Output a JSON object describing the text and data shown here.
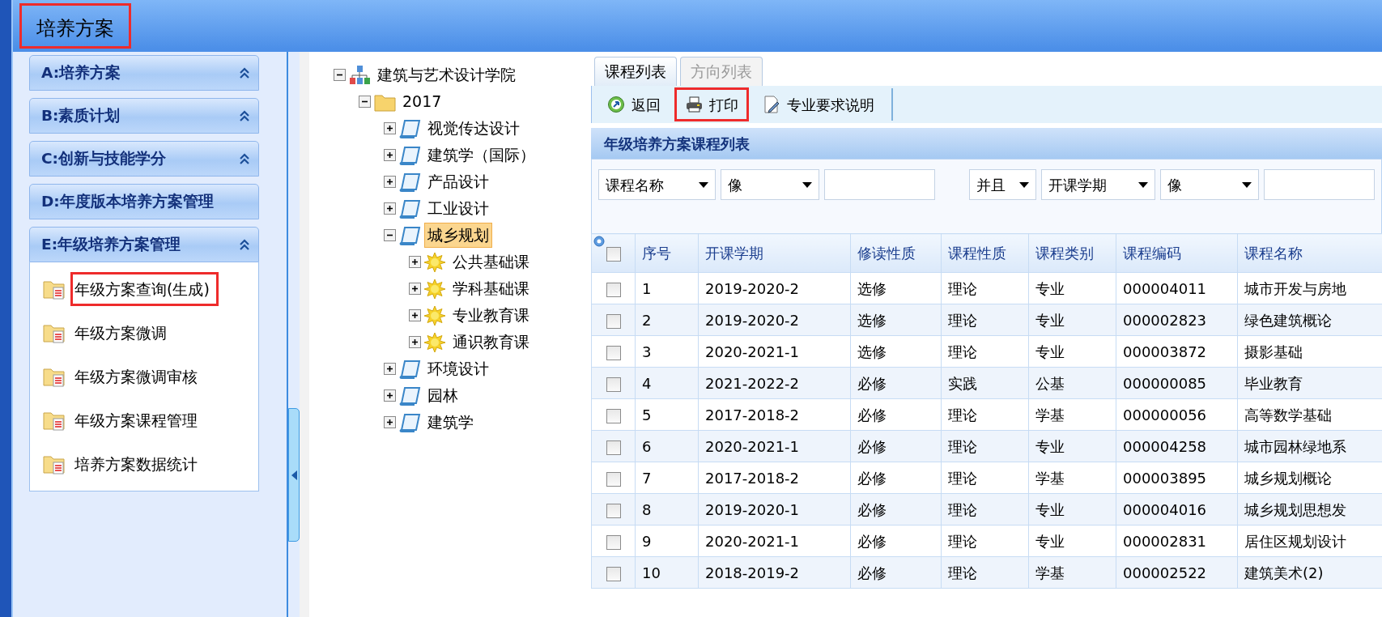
{
  "window": {
    "title": "培养方案",
    "highlighted": true
  },
  "sidebar": {
    "sections": [
      {
        "label": "A:培养方案",
        "toggle": true
      },
      {
        "label": "B:素质计划",
        "toggle": true
      },
      {
        "label": "C:创新与技能学分",
        "toggle": true
      },
      {
        "label": "D:年度版本培养方案管理",
        "toggle": false
      },
      {
        "label": "E:年级培养方案管理",
        "toggle": true,
        "expanded": true,
        "items": [
          {
            "label": "年级方案查询(生成)",
            "highlighted": true
          },
          {
            "label": "年级方案微调",
            "highlighted": false
          },
          {
            "label": "年级方案微调审核",
            "highlighted": false
          },
          {
            "label": "年级方案课程管理",
            "highlighted": false
          },
          {
            "label": "培养方案数据统计",
            "highlighted": false
          }
        ]
      }
    ]
  },
  "tree": [
    {
      "label": "建筑与艺术设计学院",
      "kind": "org",
      "expanded": true,
      "selected": false,
      "children": [
        {
          "label": "2017",
          "kind": "folder",
          "expanded": true,
          "selected": false,
          "children": [
            {
              "label": "视觉传达设计",
              "kind": "book",
              "expanded": false,
              "selected": false
            },
            {
              "label": "建筑学（国际）",
              "kind": "book",
              "expanded": false,
              "selected": false
            },
            {
              "label": "产品设计",
              "kind": "book",
              "expanded": false,
              "selected": false
            },
            {
              "label": "工业设计",
              "kind": "book",
              "expanded": false,
              "selected": false
            },
            {
              "label": "城乡规划",
              "kind": "book",
              "expanded": true,
              "selected": true,
              "children": [
                {
                  "label": "公共基础课",
                  "kind": "star",
                  "expanded": false,
                  "selected": false
                },
                {
                  "label": "学科基础课",
                  "kind": "star",
                  "expanded": false,
                  "selected": false
                },
                {
                  "label": "专业教育课",
                  "kind": "star",
                  "expanded": false,
                  "selected": false
                },
                {
                  "label": "通识教育课",
                  "kind": "star",
                  "expanded": false,
                  "selected": false
                }
              ]
            },
            {
              "label": "环境设计",
              "kind": "book",
              "expanded": false,
              "selected": false
            },
            {
              "label": "园林",
              "kind": "book",
              "expanded": false,
              "selected": false
            },
            {
              "label": "建筑学",
              "kind": "book",
              "expanded": false,
              "selected": false
            }
          ]
        }
      ]
    }
  ],
  "tabs": [
    {
      "label": "课程列表",
      "selected": true
    },
    {
      "label": "方向列表",
      "selected": false
    }
  ],
  "toolbar": [
    {
      "label": "返回",
      "kind": "back",
      "highlighted": false
    },
    {
      "label": "打印",
      "kind": "print",
      "highlighted": true
    },
    {
      "label": "专业要求说明",
      "kind": "edit",
      "highlighted": false
    }
  ],
  "grid": {
    "title": "年级培养方案课程列表",
    "filters": [
      {
        "kind": "select",
        "value": "课程名称"
      },
      {
        "kind": "select",
        "value": "像"
      },
      {
        "kind": "input"
      },
      {
        "kind": "select",
        "value": "并且"
      },
      {
        "kind": "select",
        "value": "开课学期"
      },
      {
        "kind": "select",
        "value": "像"
      },
      {
        "kind": "input"
      }
    ],
    "header_checked": false,
    "columns": [
      "序号",
      "开课学期",
      "修读性质",
      "课程性质",
      "课程类别",
      "课程编码",
      "课程名称"
    ],
    "rows": [
      {
        "checked": false,
        "cells": [
          "1",
          "2019-2020-2",
          "选修",
          "理论",
          "专业",
          "000004011",
          "城市开发与房地"
        ]
      },
      {
        "checked": false,
        "cells": [
          "2",
          "2019-2020-2",
          "选修",
          "理论",
          "专业",
          "000002823",
          "绿色建筑概论"
        ]
      },
      {
        "checked": false,
        "cells": [
          "3",
          "2020-2021-1",
          "选修",
          "理论",
          "专业",
          "000003872",
          "摄影基础"
        ]
      },
      {
        "checked": false,
        "cells": [
          "4",
          "2021-2022-2",
          "必修",
          "实践",
          "公基",
          "000000085",
          "毕业教育"
        ]
      },
      {
        "checked": false,
        "cells": [
          "5",
          "2017-2018-2",
          "必修",
          "理论",
          "学基",
          "000000056",
          "高等数学基础"
        ]
      },
      {
        "checked": false,
        "cells": [
          "6",
          "2020-2021-1",
          "必修",
          "理论",
          "专业",
          "000004258",
          "城市园林绿地系"
        ]
      },
      {
        "checked": false,
        "cells": [
          "7",
          "2017-2018-2",
          "必修",
          "理论",
          "学基",
          "000003895",
          "城乡规划概论"
        ]
      },
      {
        "checked": false,
        "cells": [
          "8",
          "2019-2020-1",
          "必修",
          "理论",
          "专业",
          "000004016",
          "城乡规划思想发"
        ]
      },
      {
        "checked": false,
        "cells": [
          "9",
          "2020-2021-1",
          "必修",
          "理论",
          "专业",
          "000002831",
          "居住区规划设计"
        ]
      },
      {
        "checked": false,
        "cells": [
          "10",
          "2018-2019-2",
          "必修",
          "理论",
          "学基",
          "000002522",
          "建筑美术(2)"
        ]
      }
    ]
  }
}
